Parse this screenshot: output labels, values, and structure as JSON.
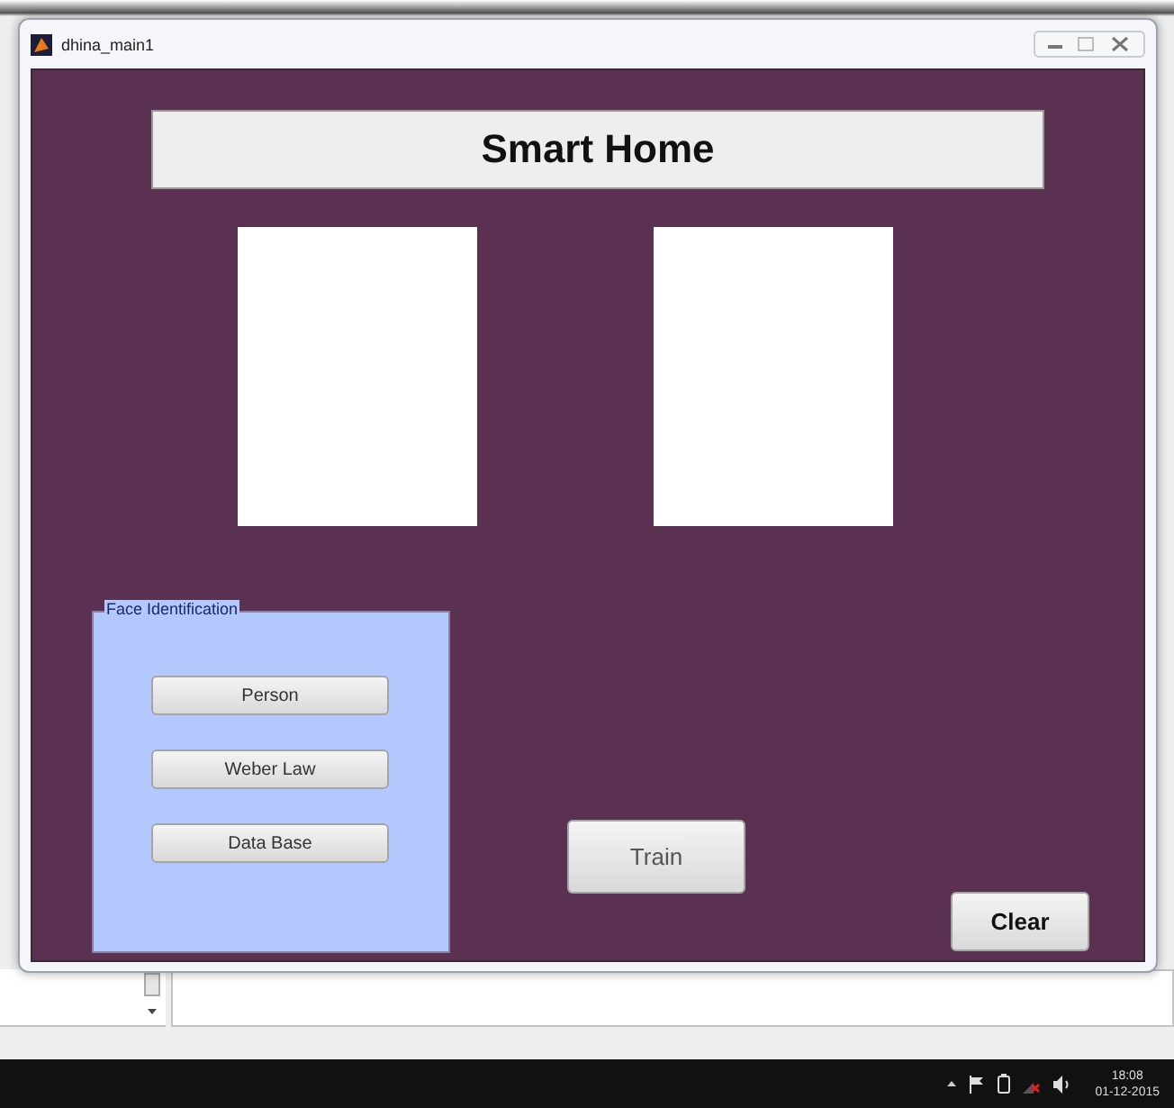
{
  "window": {
    "title": "dhina_main1"
  },
  "header": {
    "title": "Smart Home"
  },
  "panel": {
    "title": "Face Identification",
    "buttons": [
      "Person",
      "Weber Law",
      "Data Base"
    ]
  },
  "buttons": [
    {
      "label": "Train",
      "kind": "plain"
    },
    {
      "label": "Clear",
      "kind": "bold"
    }
  ],
  "taskbar": {
    "time": "18:08",
    "date": "01-12-2015"
  }
}
